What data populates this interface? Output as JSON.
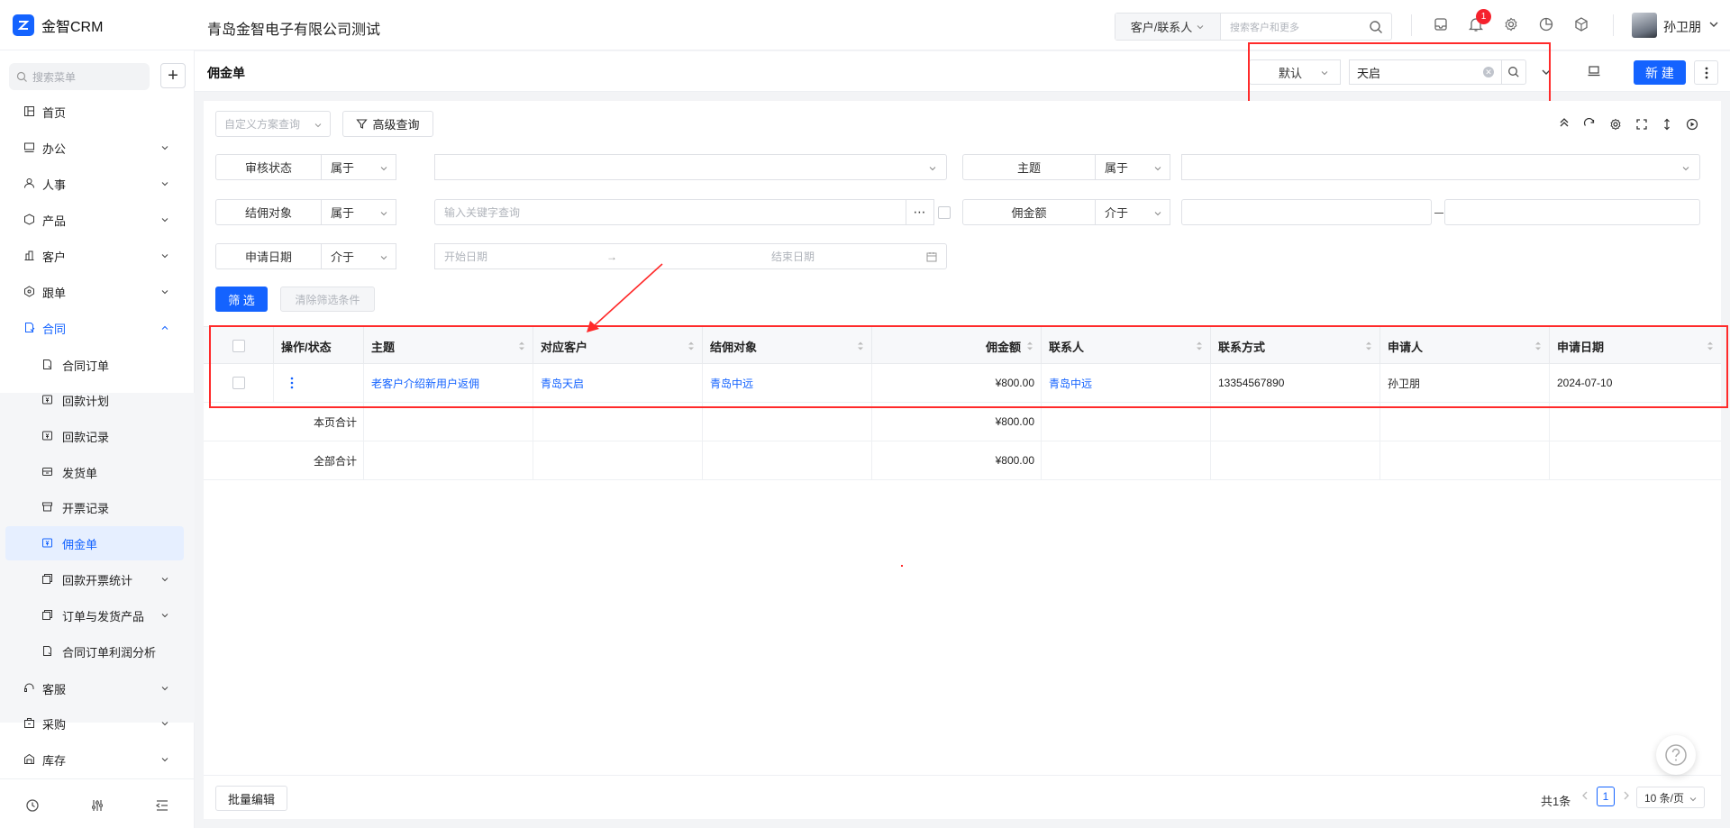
{
  "app": {
    "name": "金智CRM",
    "company": "青岛金智电子有限公司测试"
  },
  "global_search": {
    "type": "客户/联系人",
    "placeholder": "搜索客户和更多"
  },
  "notifications": {
    "count": "1"
  },
  "user": {
    "name": "孙卫朋"
  },
  "sidebar": {
    "search_placeholder": "搜索菜单",
    "items": [
      {
        "label": "首页",
        "icon": "home-icon"
      },
      {
        "label": "办公",
        "icon": "office-icon"
      },
      {
        "label": "人事",
        "icon": "hr-icon"
      },
      {
        "label": "产品",
        "icon": "product-icon"
      },
      {
        "label": "客户",
        "icon": "customer-icon"
      },
      {
        "label": "跟单",
        "icon": "follow-icon"
      },
      {
        "label": "合同",
        "icon": "contract-icon"
      },
      {
        "label": "客服",
        "icon": "service-icon"
      },
      {
        "label": "采购",
        "icon": "purchase-icon"
      },
      {
        "label": "库存",
        "icon": "inventory-icon"
      }
    ],
    "sub_items": [
      {
        "label": "合同订单"
      },
      {
        "label": "回款计划"
      },
      {
        "label": "回款记录"
      },
      {
        "label": "发货单"
      },
      {
        "label": "开票记录"
      },
      {
        "label": "佣金单"
      },
      {
        "label": "回款开票统计"
      },
      {
        "label": "订单与发货产品"
      },
      {
        "label": "合同订单利润分析"
      }
    ]
  },
  "header": {
    "title": "佣金单",
    "view": "默认",
    "query": "天启",
    "new_label": "新 建"
  },
  "toolbar": {
    "scheme_placeholder": "自定义方案查询",
    "advanced_label": "高级查询"
  },
  "filters": {
    "audit_status": {
      "label": "审核状态",
      "op": "属于"
    },
    "subject": {
      "label": "主题",
      "op": "属于"
    },
    "commission_target": {
      "label": "结佣对象",
      "op": "属于",
      "placeholder": "输入关键字查询"
    },
    "amount": {
      "label": "佣金额",
      "op": "介于"
    },
    "apply_date": {
      "label": "申请日期",
      "op": "介于",
      "start": "开始日期",
      "end": "结束日期",
      "arrow": "→"
    },
    "filter_button": "筛 选",
    "clear_button": "清除筛选条件"
  },
  "table": {
    "columns": [
      "操作/状态",
      "主题",
      "对应客户",
      "结佣对象",
      "佣金额",
      "联系人",
      "联系方式",
      "申请人",
      "申请日期"
    ],
    "rows": [
      {
        "subject": "老客户介绍新用户返佣",
        "customer": "青岛天启",
        "target": "青岛中远",
        "amount": "¥800.00",
        "contact": "青岛中远",
        "phone": "13354567890",
        "applicant": "孙卫朋",
        "date": "2024-07-10"
      }
    ],
    "page_total_label": "本页合计",
    "page_total": "¥800.00",
    "all_total_label": "全部合计",
    "all_total": "¥800.00"
  },
  "footer": {
    "batch_edit": "批量编辑",
    "total": "共1条",
    "page": "1",
    "page_size": "10 条/页"
  },
  "colors": {
    "primary": "#1463ff",
    "annotation": "#ff2a2a"
  }
}
